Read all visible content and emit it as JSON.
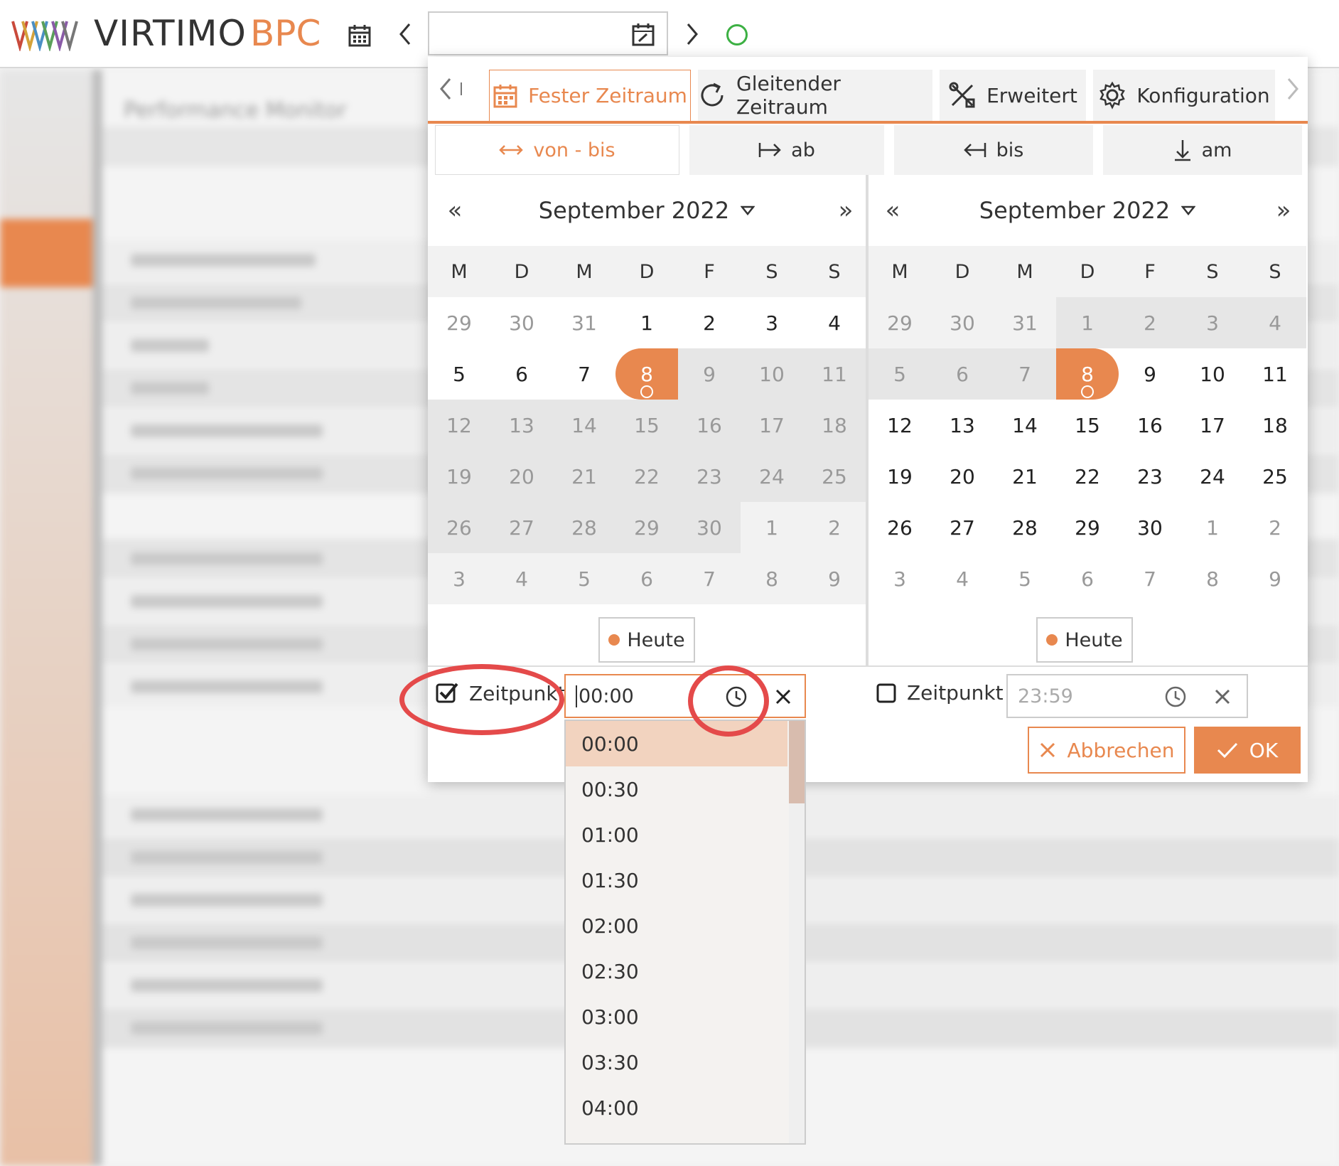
{
  "app": {
    "logo_text": "VIRTIMO",
    "logo_suffix": "BPC",
    "date_value": ""
  },
  "background": {
    "title": "Performance Monitor"
  },
  "tabs": [
    {
      "label": "Fester Zeitraum",
      "icon": "calendar-icon",
      "active": true
    },
    {
      "label": "Gleitender Zeitraum",
      "icon": "refresh-icon",
      "active": false
    },
    {
      "label": "Erweitert",
      "icon": "tools-icon",
      "active": false
    },
    {
      "label": "Konfiguration",
      "icon": "gear-icon",
      "active": false
    }
  ],
  "subtabs": [
    {
      "label": "von - bis",
      "icon": "arrows-horizontal-icon",
      "active": true
    },
    {
      "label": "ab",
      "icon": "arrow-right-bar-icon"
    },
    {
      "label": "bis",
      "icon": "arrow-left-bar-icon"
    },
    {
      "label": "am",
      "icon": "arrow-down-bar-icon"
    }
  ],
  "calendars": [
    {
      "month_label": "September 2022",
      "weekdays": [
        "M",
        "D",
        "M",
        "D",
        "F",
        "S",
        "S"
      ],
      "weeks": [
        [
          "29",
          "30",
          "31",
          "1",
          "2",
          "3",
          "4"
        ],
        [
          "5",
          "6",
          "7",
          "8",
          "9",
          "10",
          "11"
        ],
        [
          "12",
          "13",
          "14",
          "15",
          "16",
          "17",
          "18"
        ],
        [
          "19",
          "20",
          "21",
          "22",
          "23",
          "24",
          "25"
        ],
        [
          "26",
          "27",
          "28",
          "29",
          "30",
          "1",
          "2"
        ],
        [
          "3",
          "4",
          "5",
          "6",
          "7",
          "8",
          "9"
        ]
      ],
      "selected_day": "8",
      "today_label": "Heute"
    },
    {
      "month_label": "September 2022",
      "weekdays": [
        "M",
        "D",
        "M",
        "D",
        "F",
        "S",
        "S"
      ],
      "weeks": [
        [
          "29",
          "30",
          "31",
          "1",
          "2",
          "3",
          "4"
        ],
        [
          "5",
          "6",
          "7",
          "8",
          "9",
          "10",
          "11"
        ],
        [
          "12",
          "13",
          "14",
          "15",
          "16",
          "17",
          "18"
        ],
        [
          "19",
          "20",
          "21",
          "22",
          "23",
          "24",
          "25"
        ],
        [
          "26",
          "27",
          "28",
          "29",
          "30",
          "1",
          "2"
        ],
        [
          "3",
          "4",
          "5",
          "6",
          "7",
          "8",
          "9"
        ]
      ],
      "selected_day": "8",
      "today_label": "Heute"
    }
  ],
  "time_from": {
    "checkbox_label": "Zeitpunkt",
    "checked": true,
    "value": "00:00"
  },
  "time_to": {
    "checkbox_label": "Zeitpunkt",
    "checked": false,
    "placeholder": "23:59"
  },
  "buttons": {
    "cancel": "Abbrechen",
    "ok": "OK"
  },
  "time_options": [
    "00:00",
    "00:30",
    "01:00",
    "01:30",
    "02:00",
    "02:30",
    "03:00",
    "03:30",
    "04:00"
  ],
  "time_selected": "00:00",
  "colors": {
    "accent": "#e8884f",
    "status_ok": "#3cb043",
    "annotation": "#e44a4a"
  }
}
